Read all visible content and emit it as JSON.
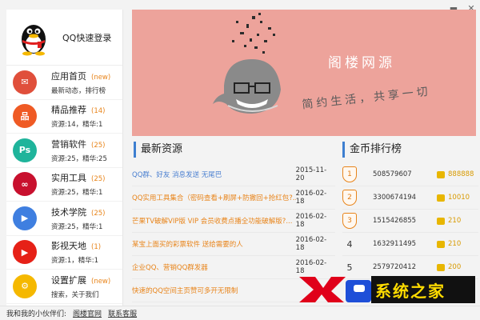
{
  "window": {
    "minimize_icon": "minimize-icon",
    "close_icon": "close-icon"
  },
  "login": {
    "label": "QQ快速登录"
  },
  "menu": [
    {
      "title": "应用首页",
      "count": "(new)",
      "sub": "最新动态，排行榜",
      "icon": "mail-icon",
      "color": "#e04f3b",
      "glyph": "✉"
    },
    {
      "title": "精品推荐",
      "count": "(14)",
      "sub": "资源:14，精华:1",
      "icon": "sitemap-icon",
      "color": "#ef5a24",
      "glyph": "品"
    },
    {
      "title": "营销软件",
      "count": "(25)",
      "sub": "资源:25，精华:25",
      "icon": "photoshop-icon",
      "color": "#1fb49b",
      "glyph": "Ps"
    },
    {
      "title": "实用工具",
      "count": "(25)",
      "sub": "资源:25，精华:1",
      "icon": "creative-cloud-icon",
      "color": "#c8102e",
      "glyph": "∞"
    },
    {
      "title": "技术学院",
      "count": "(25)",
      "sub": "资源:25，精华:1",
      "icon": "video-icon",
      "color": "#3f7fe0",
      "glyph": "▶"
    },
    {
      "title": "影视天地",
      "count": "(1)",
      "sub": "资源:1，精华:1",
      "icon": "youtube-icon",
      "color": "#e62117",
      "glyph": "▶"
    },
    {
      "title": "设置扩展",
      "count": "(new)",
      "sub": "搜索，关于我们",
      "icon": "gear-icon",
      "color": "#f5b800",
      "glyph": "⚙"
    }
  ],
  "footer": {
    "label": "我和我的小伙伴们:",
    "links": [
      "阁楼官网",
      "联系客服"
    ]
  },
  "banner": {
    "title": "阁楼网源",
    "slogan": "简约生活，共享一切"
  },
  "latest": {
    "heading": "最新资源",
    "rows": [
      {
        "title": "QQ群、好友 消息发送 无尾巴",
        "date": "2015-11-20",
        "color": "#4a7fd0"
      },
      {
        "title": "QQ实用工具集合（密码查看+刷屏+防撤回+抢红包?...",
        "date": "2016-02-18",
        "color": "#e8841a"
      },
      {
        "title": "芒果TV破解VIP版 VIP 会员收费点播全功能破解版?...",
        "date": "2016-02-18",
        "color": "#e8841a"
      },
      {
        "title": "某宝上面买的彩票软件 送给需要的人",
        "date": "2016-02-18",
        "color": "#e8841a"
      },
      {
        "title": "企业QQ、营销QQ群发器",
        "date": "2016-02-18",
        "color": "#e8841a"
      },
      {
        "title": "快速的QQ空间主页赞可多开无限制",
        "date": "",
        "color": "#e8841a"
      }
    ]
  },
  "ranking": {
    "heading": "金币排行榜",
    "rows": [
      {
        "rank": "1",
        "qq": "508579607",
        "score": "888888",
        "medal": true
      },
      {
        "rank": "2",
        "qq": "3300674194",
        "score": "10010",
        "medal": true
      },
      {
        "rank": "3",
        "qq": "1515426855",
        "score": "210",
        "medal": true
      },
      {
        "rank": "4",
        "qq": "1632911495",
        "score": "210",
        "medal": false
      },
      {
        "rank": "5",
        "qq": "2579720412",
        "score": "200",
        "medal": false
      }
    ]
  },
  "watermark": {
    "text": "系统之家"
  }
}
